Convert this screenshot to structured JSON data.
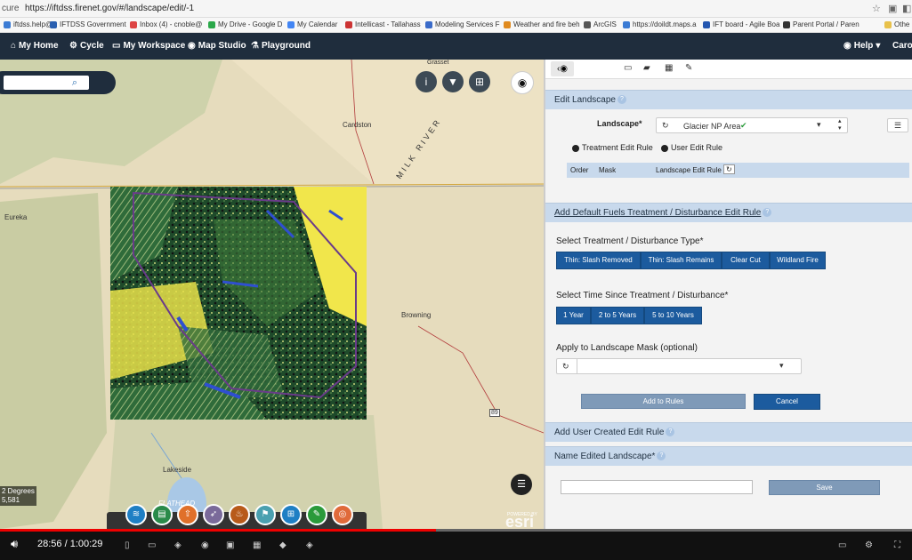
{
  "browser": {
    "secure_label": "cure",
    "url": "https://iftdss.firenet.gov/#/landscape/edit/-1",
    "bookmarks": [
      {
        "label": "iftdss.help@",
        "color": "#3b7bd4"
      },
      {
        "label": "IFTDSS Government",
        "color": "#2a5fb0"
      },
      {
        "label": "Inbox (4) - cnoble@",
        "color": "#d44"
      },
      {
        "label": "My Drive - Google D",
        "color": "#2ba84a"
      },
      {
        "label": "My Calendar",
        "color": "#4285f4"
      },
      {
        "label": "Intellicast - Tallahass",
        "color": "#c33"
      },
      {
        "label": "Modeling Services F",
        "color": "#3a6bc9"
      },
      {
        "label": "Weather and fire beh",
        "color": "#e08a1e"
      },
      {
        "label": "ArcGIS",
        "color": "#555"
      },
      {
        "label": "https://doildt.maps.a",
        "color": "#3b7bd4"
      },
      {
        "label": "IFT board - Agile Boa",
        "color": "#2356b0"
      },
      {
        "label": "Parent Portal / Paren",
        "color": "#333"
      },
      {
        "label": "Othe",
        "color": "#e8c14a"
      }
    ]
  },
  "nav": {
    "items": [
      "My Home",
      "Cycle",
      "My Workspace",
      "Map Studio",
      "Playground"
    ],
    "help": "Help",
    "user": "Carol"
  },
  "map": {
    "labels": {
      "cardston": "Cardston",
      "eureka": "Eureka",
      "browning": "Browning",
      "lakeside": "Lakeside",
      "milk_river": "MILK RIVER",
      "flathead": "FLATHEAD",
      "grasset": "Grasset",
      "route_89": "89"
    },
    "scale_line1": "2 Degrees",
    "scale_line2": "5,581",
    "esri": "esri",
    "powered_by": "POWERED BY",
    "tool_colors": [
      "#1f7fc4",
      "#2a8a4a",
      "#e0702a",
      "#7a6a9a",
      "#b85a1a",
      "#4aa0b0",
      "#1f7fc4",
      "#2a9a3a",
      "#e06a3a"
    ]
  },
  "panel": {
    "edit_landscape_title": "Edit Landscape",
    "landscape_label": "Landscape*",
    "landscape_value": "Glacier NP Area",
    "radio_treatment": "Treatment Edit Rule",
    "radio_user": "User Edit Rule",
    "table_cols": [
      "Order",
      "Mask",
      "Landscape Edit Rule"
    ],
    "add_default_title": "Add Default Fuels Treatment / Disturbance Edit Rule",
    "select_type_label": "Select Treatment / Disturbance Type*",
    "type_buttons": [
      "Thin: Slash Removed",
      "Thin: Slash Remains",
      "Clear Cut",
      "Wildland Fire"
    ],
    "select_time_label": "Select Time Since Treatment / Disturbance*",
    "time_buttons": [
      "1 Year",
      "2 to 5 Years",
      "5 to 10 Years"
    ],
    "mask_label": "Apply to Landscape Mask (optional)",
    "add_to_rules": "Add to Rules",
    "cancel": "Cancel",
    "add_user_title": "Add User Created Edit Rule",
    "name_title": "Name Edited Landscape*",
    "save": "Save"
  },
  "video": {
    "time": "28:56 / 1:00:29",
    "progress_fraction": 0.478
  }
}
